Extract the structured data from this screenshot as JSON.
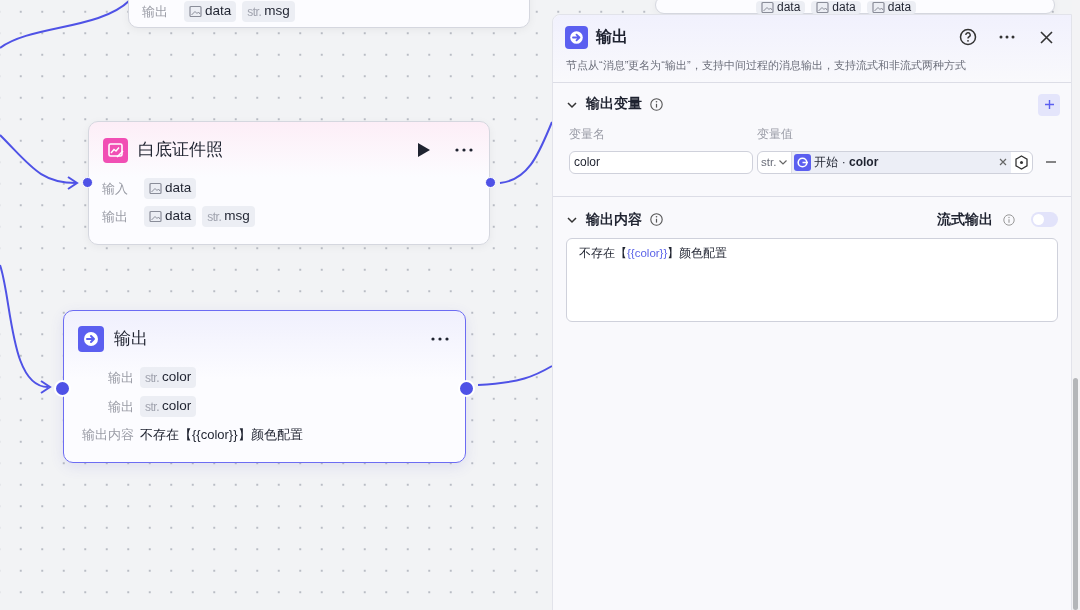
{
  "canvas": {
    "nodes": [
      {
        "kind": "partial",
        "selected": false,
        "rows": [
          {
            "label": "输出",
            "tags": [
              {
                "kind": "image",
                "name": "data"
              },
              {
                "kind": "typed",
                "prefix": "str.",
                "name": "msg"
              }
            ]
          }
        ]
      },
      {
        "kind": "hidden",
        "selected": false,
        "rows": [
          {
            "tags": [
              {
                "kind": "image",
                "name": "data"
              },
              {
                "kind": "image",
                "name": "data"
              },
              {
                "kind": "image",
                "name": "data"
              }
            ]
          }
        ]
      },
      {
        "kind": "plugin",
        "selected": false,
        "title": "白底证件照",
        "runnable": true,
        "rows": [
          {
            "label": "输入",
            "tags": [
              {
                "kind": "image",
                "name": "data"
              }
            ]
          },
          {
            "label": "输出",
            "tags": [
              {
                "kind": "image",
                "name": "data"
              },
              {
                "kind": "typed",
                "prefix": "str.",
                "name": "msg"
              }
            ]
          }
        ]
      },
      {
        "kind": "output",
        "selected": true,
        "title": "输出",
        "runnable": false,
        "rows": [
          {
            "label": "输出",
            "tags": [
              {
                "kind": "typed",
                "prefix": "str.",
                "name": "color"
              }
            ]
          },
          {
            "label": "输出",
            "tags": [
              {
                "kind": "typed",
                "prefix": "str.",
                "name": "color"
              }
            ]
          },
          {
            "label": "输出内容",
            "text": "不存在【{{color}}】颜色配置"
          }
        ]
      }
    ]
  },
  "panel": {
    "title": "输出",
    "description": "节点从“消息”更名为“输出”，支持中间过程的消息输出，支持流式和非流式两种方式",
    "variables": {
      "title": "输出变量",
      "expanded": true,
      "columns": [
        "变量名",
        "变量值"
      ],
      "rows": [
        {
          "name": "color",
          "type": "str.",
          "source": "开始 · **color**"
        }
      ]
    },
    "content": {
      "title": "输出内容",
      "expanded": true,
      "stream_label": "流式输出",
      "stream_on": false,
      "text": "不存在【{{color}}】颜色配置"
    }
  }
}
